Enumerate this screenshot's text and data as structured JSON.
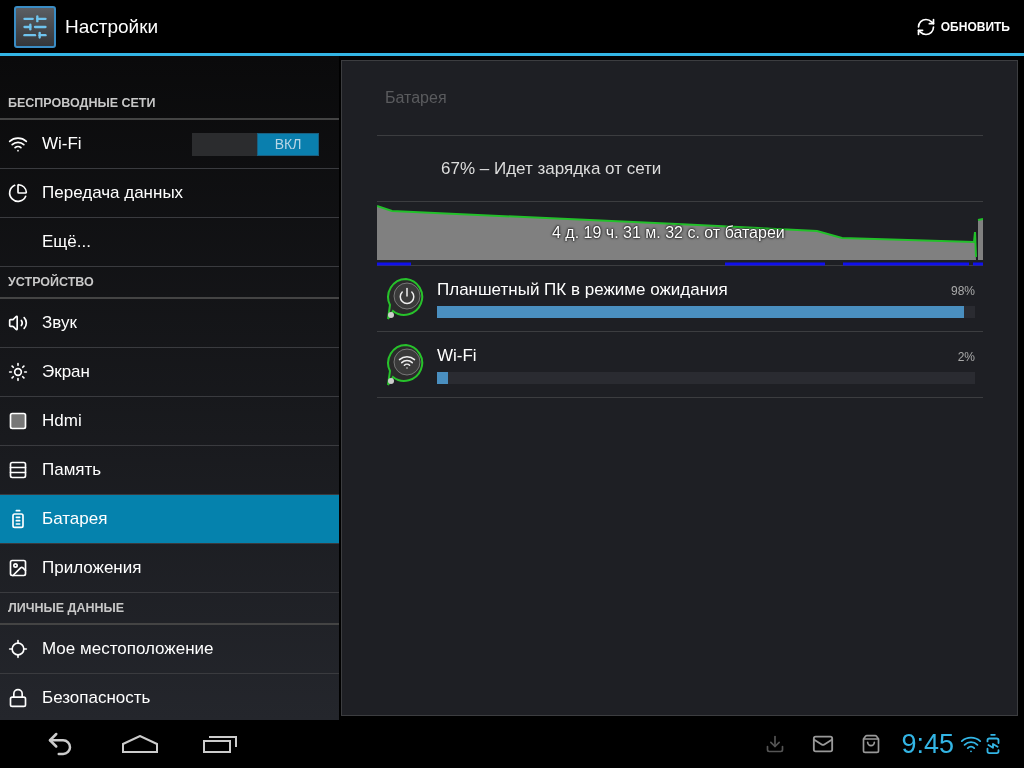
{
  "action_bar": {
    "title": "Настройки",
    "refresh_button": "ОБНОВИТЬ"
  },
  "sidebar": {
    "sections": [
      {
        "header": "БЕСПРОВОДНЫЕ СЕТИ",
        "items": [
          {
            "label": "Wi-Fi",
            "selected": false,
            "toggle": {
              "on": true,
              "label": "ВКЛ"
            }
          },
          {
            "label": "Передача данных",
            "selected": false
          },
          {
            "label": "Ещё...",
            "selected": false
          }
        ]
      },
      {
        "header": "УСТРОЙСТВО",
        "items": [
          {
            "label": "Звук",
            "selected": false
          },
          {
            "label": "Экран",
            "selected": false
          },
          {
            "label": "Hdmi",
            "selected": false
          },
          {
            "label": "Память",
            "selected": false
          },
          {
            "label": "Батарея",
            "selected": true
          },
          {
            "label": "Приложения",
            "selected": false
          }
        ]
      },
      {
        "header": "ЛИЧНЫЕ ДАННЫЕ",
        "items": [
          {
            "label": "Мое местоположение",
            "selected": false
          },
          {
            "label": "Безопасность",
            "selected": false
          }
        ]
      }
    ]
  },
  "content": {
    "title": "Батарея",
    "status": "67% – Идет зарядка от сети",
    "graph_caption": "4 д. 19 ч. 31 м. 32 с. от батареи",
    "usage": [
      {
        "label": "Планшетный ПК в режиме ожидания",
        "percent": "98%",
        "level": 0.98
      },
      {
        "label": "Wi-Fi",
        "percent": "2%",
        "level": 0.02
      }
    ]
  },
  "system_bar": {
    "time": "9:45"
  }
}
